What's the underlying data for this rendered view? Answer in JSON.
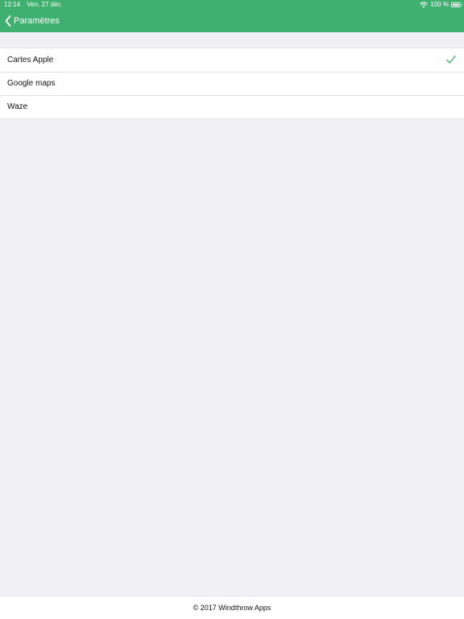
{
  "status_bar": {
    "time": "12:14",
    "date": "Ven. 27 déc.",
    "battery": "100 %"
  },
  "nav": {
    "back_label": "Paramètres"
  },
  "options": [
    {
      "label": "Cartes Apple",
      "selected": true
    },
    {
      "label": "Google maps",
      "selected": false
    },
    {
      "label": "Waze",
      "selected": false
    }
  ],
  "footer": {
    "text": "© 2017 Windthrow Apps"
  },
  "colors": {
    "accent": "#3fb06f",
    "background": "#f0f0f5"
  },
  "icons": {
    "back": "chevron-left-icon",
    "selected": "checkmark-icon",
    "wifi": "wifi-icon",
    "battery": "battery-icon"
  }
}
